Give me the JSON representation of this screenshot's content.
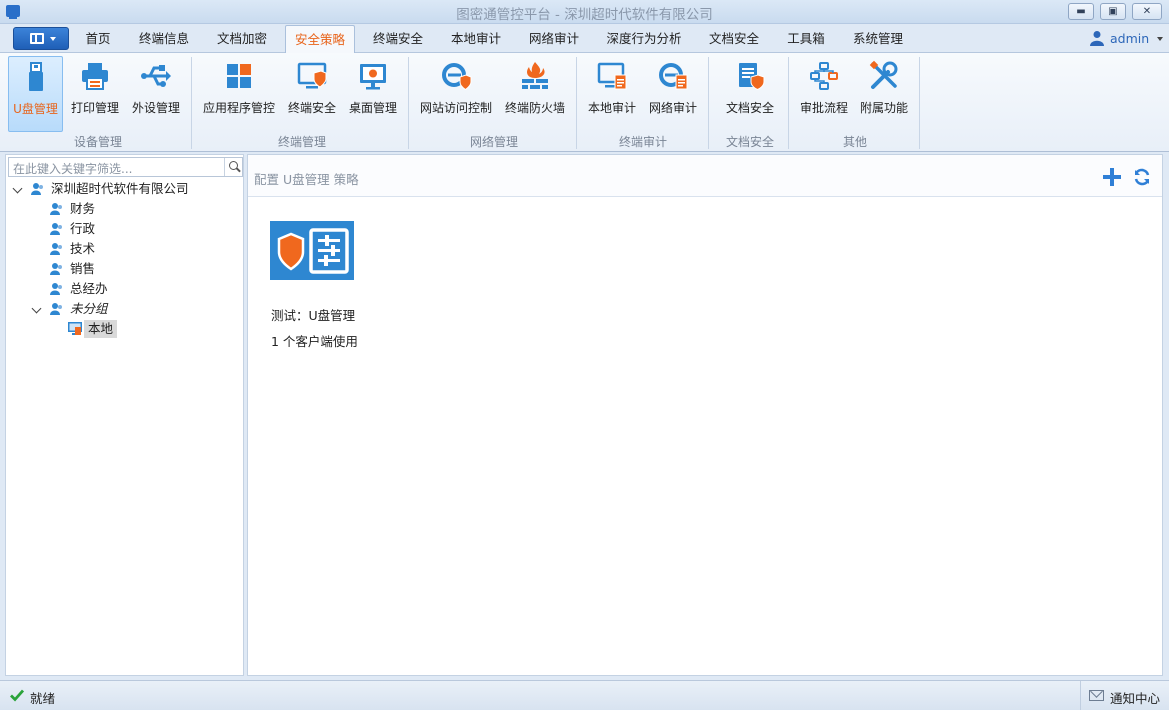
{
  "window": {
    "title": "图密通管控平台 - 深圳超时代软件有限公司"
  },
  "tabs": [
    {
      "label": "首页",
      "active": false
    },
    {
      "label": "终端信息",
      "active": false
    },
    {
      "label": "文档加密",
      "active": false
    },
    {
      "label": "安全策略",
      "active": true
    },
    {
      "label": "终端安全",
      "active": false
    },
    {
      "label": "本地审计",
      "active": false
    },
    {
      "label": "网络审计",
      "active": false
    },
    {
      "label": "深度行为分析",
      "active": false
    },
    {
      "label": "文档安全",
      "active": false
    },
    {
      "label": "工具箱",
      "active": false
    },
    {
      "label": "系统管理",
      "active": false
    }
  ],
  "user": {
    "name": "admin"
  },
  "ribbon": {
    "groups": [
      {
        "label": "设备管理",
        "items": [
          {
            "label": "U盘管理",
            "icon": "usb-drive-icon",
            "active": true
          },
          {
            "label": "打印管理",
            "icon": "printer-icon",
            "active": false
          },
          {
            "label": "外设管理",
            "icon": "usb-symbol-icon",
            "active": false
          }
        ]
      },
      {
        "label": "终端管理",
        "items": [
          {
            "label": "应用程序管控",
            "icon": "app-grid-icon"
          },
          {
            "label": "终端安全",
            "icon": "monitor-shield-icon"
          },
          {
            "label": "桌面管理",
            "icon": "desktop-icon"
          }
        ]
      },
      {
        "label": "网络管理",
        "items": [
          {
            "label": "网站访问控制",
            "icon": "browser-shield-icon"
          },
          {
            "label": "终端防火墙",
            "icon": "firewall-icon"
          }
        ]
      },
      {
        "label": "终端审计",
        "items": [
          {
            "label": "本地审计",
            "icon": "monitor-doc-icon"
          },
          {
            "label": "网络审计",
            "icon": "browser-doc-icon"
          }
        ]
      },
      {
        "label": "文档安全",
        "items": [
          {
            "label": "文档安全",
            "icon": "document-shield-icon"
          }
        ]
      },
      {
        "label": "其他",
        "items": [
          {
            "label": "审批流程",
            "icon": "workflow-icon"
          },
          {
            "label": "附属功能",
            "icon": "tools-icon"
          }
        ]
      }
    ]
  },
  "tree": {
    "search_placeholder": "在此键入关键字筛选...",
    "root": "深圳超时代软件有限公司",
    "children": [
      "财务",
      "行政",
      "技术",
      "销售",
      "总经办"
    ],
    "ungrouped": "未分组",
    "local": "本地"
  },
  "main": {
    "breadcrumb": "配置 U盘管理 策略",
    "policy": {
      "name": "测试：U盘管理",
      "usage": "1 个客户端使用"
    }
  },
  "status": {
    "ready": "就绪",
    "notify": "通知中心"
  },
  "colors": {
    "accent": "#e8641b",
    "blue": "#2e87d1",
    "orange": "#f0681e"
  }
}
